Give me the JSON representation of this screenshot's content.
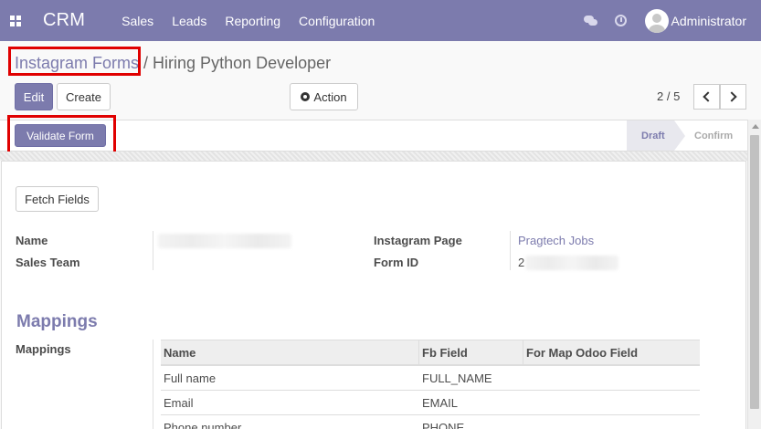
{
  "navbar": {
    "brand": "CRM",
    "menu": [
      "Sales",
      "Leads",
      "Reporting",
      "Configuration"
    ],
    "user_name": "Administrator"
  },
  "breadcrumb": {
    "parent": "Instagram Forms",
    "separator": " / ",
    "current": "Hiring Python Developer"
  },
  "buttons": {
    "edit": "Edit",
    "create": "Create",
    "action": "Action",
    "validate": "Validate Form",
    "fetch_fields": "Fetch Fields"
  },
  "pager": {
    "value": "2 / 5"
  },
  "statusbar": {
    "stages": [
      "Draft",
      "Confirm"
    ],
    "active": "Draft"
  },
  "form": {
    "labels": {
      "name": "Name",
      "sales_team": "Sales Team",
      "instagram_page": "Instagram Page",
      "form_id": "Form ID"
    },
    "instagram_page_value": "Pragtech Jobs",
    "form_id_prefix": "2"
  },
  "mappings": {
    "section_title": "Mappings",
    "field_label": "Mappings",
    "columns": [
      "Name",
      "Fb Field",
      "For Map Odoo Field"
    ],
    "rows": [
      [
        "Full name",
        "FULL_NAME",
        ""
      ],
      [
        "Email",
        "EMAIL",
        ""
      ],
      [
        "Phone number",
        "PHONE",
        ""
      ]
    ]
  },
  "colors": {
    "accent": "#7c7bad",
    "highlight": "#e00000"
  }
}
